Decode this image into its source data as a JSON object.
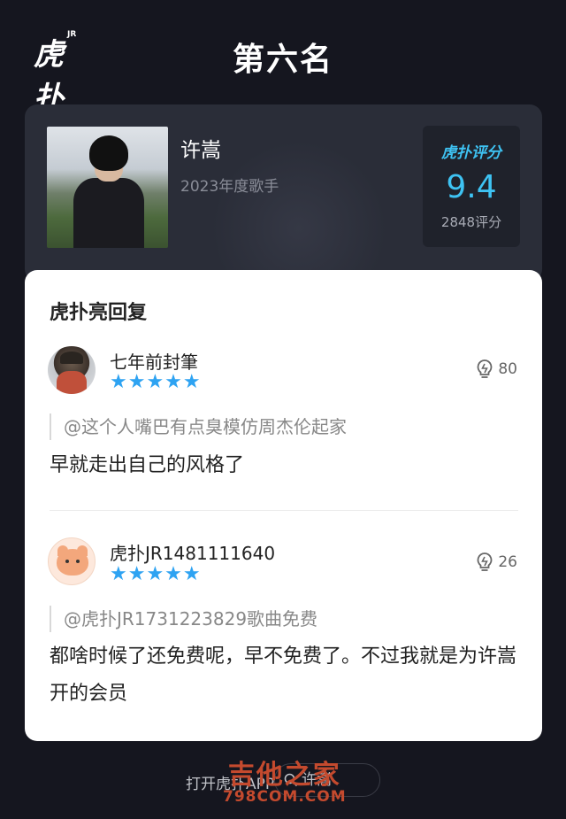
{
  "header": {
    "logo_text": "虎扑",
    "logo_badge": "JR",
    "title": "第六名"
  },
  "singer": {
    "name": "许嵩",
    "subtitle": "2023年度歌手",
    "score_label": "虎扑评分",
    "score": "9.4",
    "score_count": "2848评分"
  },
  "replies_panel": {
    "title": "虎扑亮回复",
    "replies": [
      {
        "username": "七年前封筆",
        "stars": "★★★★★",
        "likes": "80",
        "quote": "@这个人嘴巴有点臭模仿周杰伦起家",
        "text": "早就走出自己的风格了"
      },
      {
        "username": "虎扑JR1481111640",
        "stars": "★★★★★",
        "likes": "26",
        "quote": "@虎扑JR1731223829歌曲免费",
        "text": "都啥时候了还免费呢，早不免费了。不过我就是为许嵩开的会员"
      }
    ]
  },
  "bottom": {
    "open_app": "打开虎扑APP",
    "search_text": "许嵩"
  },
  "watermark": {
    "main": "吉他之家",
    "url": "798COM.COM"
  },
  "colors": {
    "background": "#15161f",
    "accent": "#3ec3f3",
    "star": "#2ea3f2"
  }
}
